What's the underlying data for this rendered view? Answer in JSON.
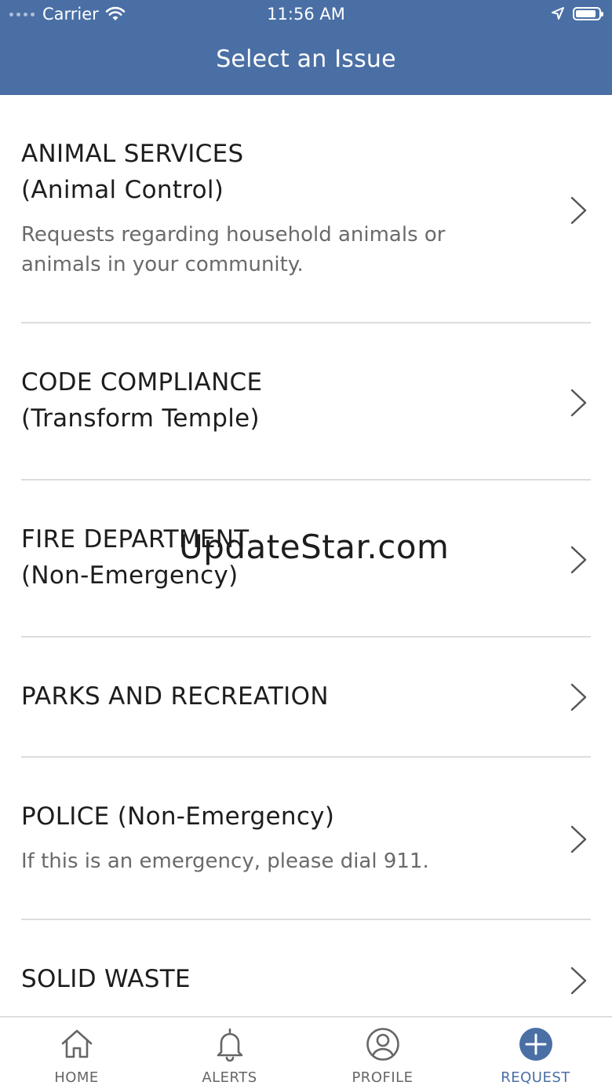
{
  "status_bar": {
    "carrier": "Carrier",
    "time": "11:56 AM",
    "battery_level": 0.9
  },
  "header": {
    "title": "Select an Issue"
  },
  "issues": [
    {
      "title": "ANIMAL SERVICES\n(Animal Control)",
      "description": "Requests regarding household animals or animals in your community."
    },
    {
      "title": "CODE COMPLIANCE\n(Transform Temple)",
      "description": ""
    },
    {
      "title": "FIRE DEPARTMENT\n(Non-Emergency)",
      "description": ""
    },
    {
      "title": "PARKS AND RECREATION",
      "description": ""
    },
    {
      "title": "POLICE (Non-Emergency)",
      "description": "If this is an emergency, please dial 911."
    },
    {
      "title": "SOLID WASTE",
      "description": ""
    }
  ],
  "watermark": "UpdateStar.com",
  "tab_bar": {
    "tabs": [
      {
        "label": "HOME",
        "icon": "home-icon",
        "active": false
      },
      {
        "label": "ALERTS",
        "icon": "bell-icon",
        "active": false
      },
      {
        "label": "PROFILE",
        "icon": "user-circle-icon",
        "active": false
      },
      {
        "label": "REQUEST",
        "icon": "plus-circle-icon",
        "active": true
      }
    ]
  },
  "colors": {
    "header": "#4a6fa5",
    "accent": "#4a6fa5",
    "title_text": "#1d1d1d",
    "desc_text": "#6a6a6a",
    "divider": "#dcdcdc"
  }
}
